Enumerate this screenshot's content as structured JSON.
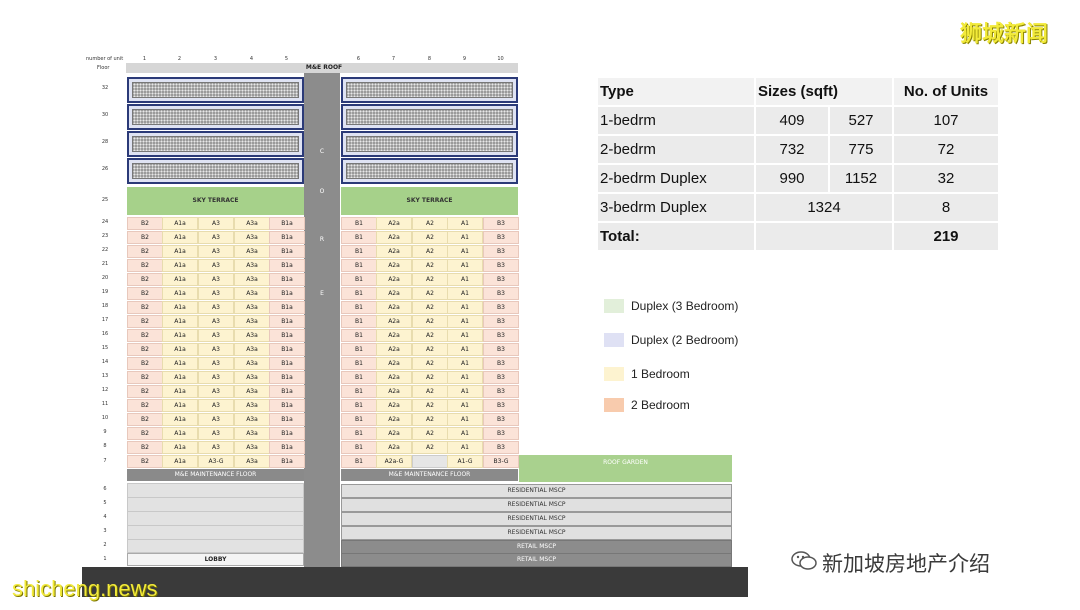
{
  "watermarks": {
    "top_right": "狮城新闻",
    "bottom_left": "shicheng.news",
    "bottom_right": "新加坡房地产介绍"
  },
  "header": {
    "number_of_unit": "number of unit",
    "floor": "Floor",
    "unit_numbers": [
      "1",
      "2",
      "3",
      "4",
      "5",
      "6",
      "7",
      "8",
      "9",
      "10"
    ],
    "me_roof": "M&E ROOF"
  },
  "floors": {
    "duplex": [
      "32",
      "30",
      "28",
      "26"
    ],
    "sky": "25",
    "typical": [
      "24",
      "23",
      "22",
      "21",
      "20",
      "19",
      "18",
      "17",
      "16",
      "15",
      "14",
      "13",
      "12",
      "11",
      "10",
      "9",
      "8"
    ],
    "seventh": "7",
    "podium": [
      "6",
      "5",
      "4",
      "3",
      "2",
      "1"
    ]
  },
  "labels": {
    "sky_terrace": "SKY TERRACE",
    "core_letters": [
      "C",
      "O",
      "R",
      "E"
    ],
    "me_maintenance": "M&E MAINTENANCE FLOOR",
    "roof_garden": "ROOF GARDEN",
    "residential_mscp": "RESIDENTIAL MSCP",
    "retail_mscp": "RETAIL MSCP",
    "lobby": "LOBBY"
  },
  "unit_types": {
    "typical": [
      "B2",
      "A1a",
      "A3",
      "A3a",
      "B1a",
      "B1",
      "A2a",
      "A2",
      "A1",
      "B3"
    ],
    "seventh": [
      "B2",
      "A1a",
      "A3-G",
      "A3a",
      "B1a",
      "B1",
      "A2a-G",
      "",
      "A1-G",
      "B3-G"
    ]
  },
  "table": {
    "headers": [
      "Type",
      "Sizes (sqft)",
      "No. of Units"
    ],
    "rows": [
      {
        "type": "1-bedrm",
        "min": "409",
        "max": "527",
        "units": "107"
      },
      {
        "type": "2-bedrm",
        "min": "732",
        "max": "775",
        "units": "72"
      },
      {
        "type": "2-bedrm Duplex",
        "min": "990",
        "max": "1152",
        "units": "32"
      },
      {
        "type": "3-bedrm Duplex",
        "size": "1324",
        "units": "8"
      }
    ],
    "total_label": "Total:",
    "total_units": "219"
  },
  "legend": [
    {
      "label": "Duplex (3 Bedroom)",
      "color": "#e2efda"
    },
    {
      "label": "Duplex (2 Bedroom)",
      "color": "#dfe1f4"
    },
    {
      "label": "1 Bedroom",
      "color": "#fdf3d0"
    },
    {
      "label": "2 Bedroom",
      "color": "#f8cbad"
    }
  ]
}
